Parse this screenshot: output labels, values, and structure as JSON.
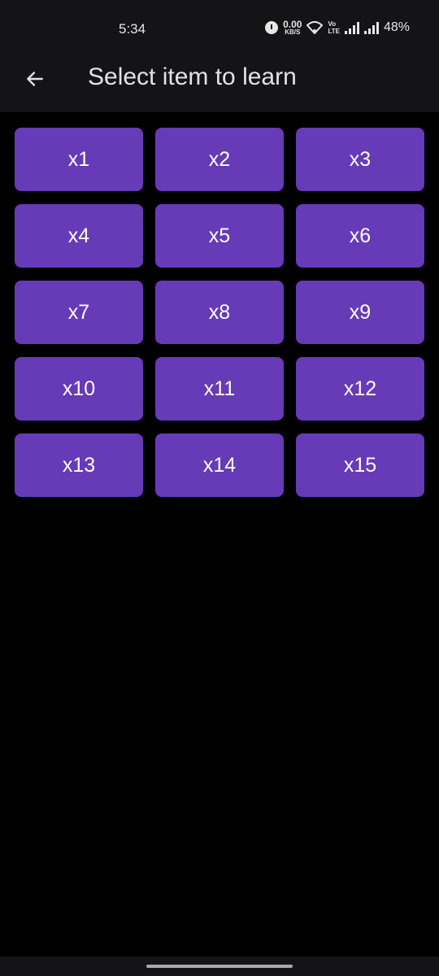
{
  "status_bar": {
    "time": "5:34",
    "net_speed_value": "0.00",
    "net_speed_unit": "KB/S",
    "volte_top": "Vo",
    "volte_bottom": "LTE",
    "battery": "48%"
  },
  "app_bar": {
    "title": "Select item to learn",
    "back_icon": "arrow-back-icon"
  },
  "items": [
    "x1",
    "x2",
    "x3",
    "x4",
    "x5",
    "x6",
    "x7",
    "x8",
    "x9",
    "x10",
    "x11",
    "x12",
    "x13",
    "x14",
    "x15"
  ],
  "colors": {
    "button": "#673ab7",
    "background": "#000000",
    "bar": "#141316"
  }
}
